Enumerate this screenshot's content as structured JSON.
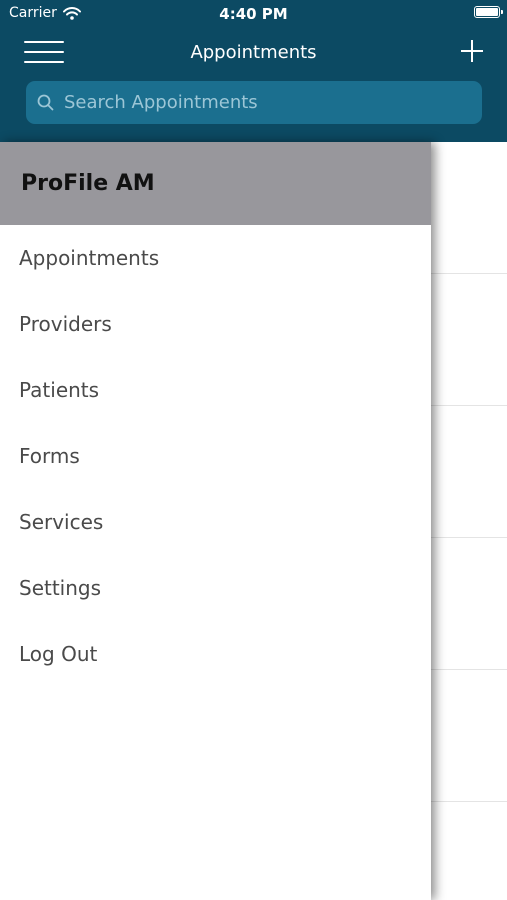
{
  "status_bar": {
    "carrier": "Carrier",
    "time": "4:40 PM",
    "wifi_icon": "wifi-icon",
    "battery_icon": "battery-icon"
  },
  "nav": {
    "title": "Appointments",
    "menu_icon": "hamburger-menu-icon",
    "add_icon": "plus-icon"
  },
  "search": {
    "placeholder": "Search Appointments",
    "value": ""
  },
  "drawer": {
    "title": "ProFile AM",
    "items": [
      {
        "label": "Appointments"
      },
      {
        "label": "Providers"
      },
      {
        "label": "Patients"
      },
      {
        "label": "Forms"
      },
      {
        "label": "Services"
      },
      {
        "label": "Settings"
      },
      {
        "label": "Log Out"
      }
    ]
  },
  "colors": {
    "header": "#0c4a63",
    "search_bg": "#1b6f8f",
    "drawer_header": "#98979c"
  }
}
